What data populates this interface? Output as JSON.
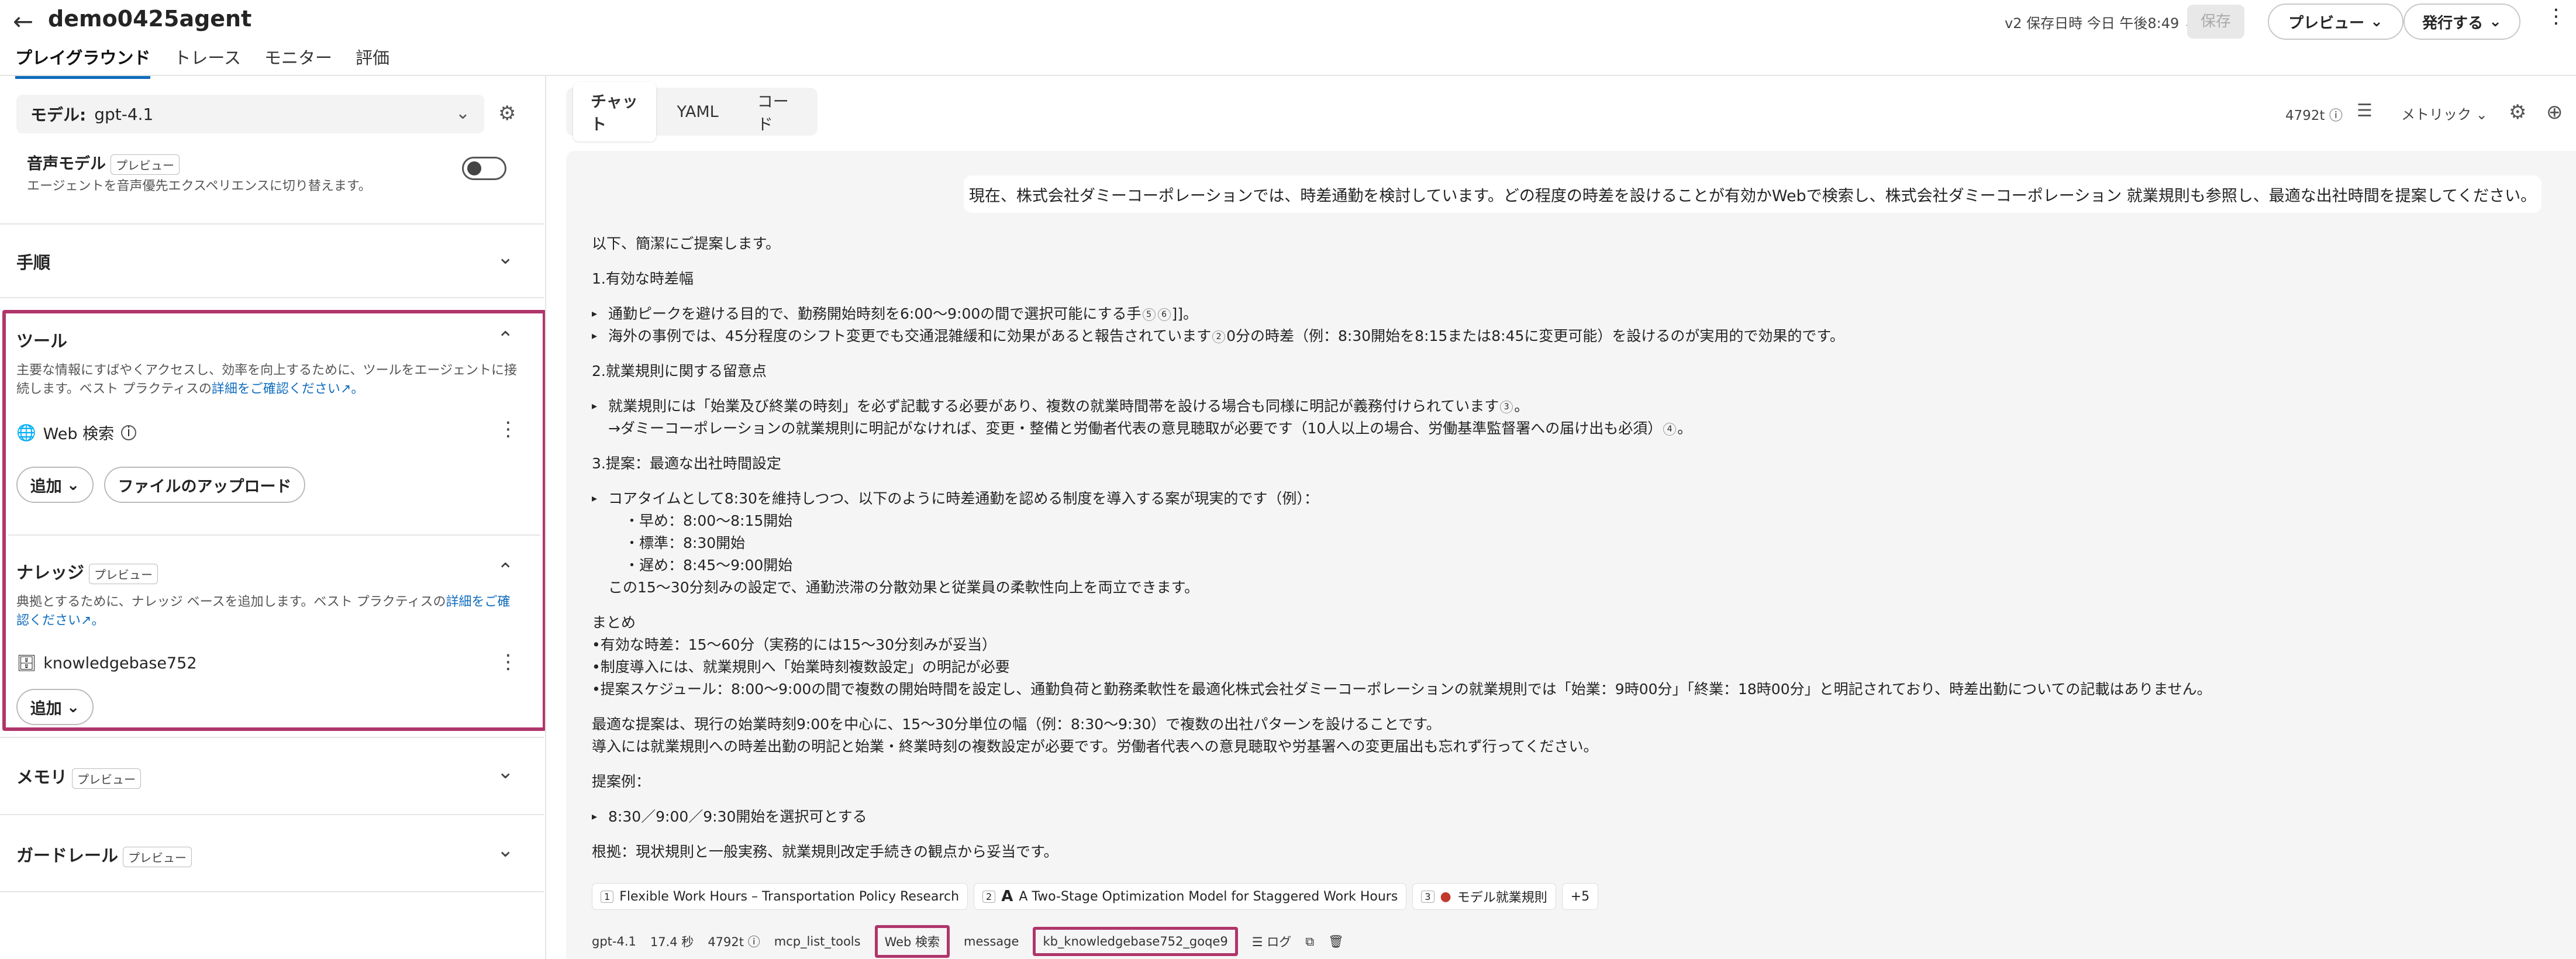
{
  "header": {
    "title": "demo0425agent",
    "tabs": [
      "プレイグラウンド",
      "トレース",
      "モニター",
      "評価"
    ],
    "saved_info": "v2 保存日時 今日 午後8:49",
    "save_label": "保存",
    "preview_label": "プレビュー",
    "publish_label": "発行する"
  },
  "left": {
    "model_prefix": "モデル:",
    "model_value": "gpt-4.1",
    "voice": {
      "label": "音声モデル",
      "badge": "プレビュー",
      "desc": "エージェントを音声優先エクスペリエンスに切り替えます。"
    },
    "instructions_title": "手順",
    "tools": {
      "title": "ツール",
      "desc": "主要な情報にすばやくアクセスし、効率を向上するために、ツールをエージェントに接続します。ベスト プラクティスの",
      "link": "詳細をご確認ください",
      "item": "Web 検索",
      "add_label": "追加",
      "upload_label": "ファイルのアップロード"
    },
    "knowledge": {
      "title": "ナレッジ",
      "badge": "プレビュー",
      "desc": "典拠とするために、ナレッジ ベースを追加します。ベスト プラクティスの",
      "link": "詳細をご確認ください",
      "item": "knowledgebase752",
      "add_label": "追加"
    },
    "memory": {
      "title": "メモリ",
      "badge": "プレビュー"
    },
    "guardrail": {
      "title": "ガードレール",
      "badge": "プレビュー"
    }
  },
  "right": {
    "tabs": [
      "チャット",
      "YAML",
      "コード"
    ],
    "tokens": "4792t",
    "metric_label": "メトリック",
    "user_message": "現在、株式会社ダミーコーポレーションでは、時差通勤を検討しています。どの程度の時差を設けることが有効かWebで検索し、株式会社ダミーコーポレーション 就業規則も参照し、最適な出社時間を提案してください。",
    "answer": {
      "intro": "以下、簡潔にご提案します。",
      "s1": "1.有効な時差幅",
      "s1b1": "通勤ピークを避ける目的で、勤務開始時刻を6:00〜9:00の間で選択可能にする手",
      "s1b1_cites": [
        "5",
        "6"
      ],
      "s1b1_end": "]]。",
      "s1b2": "海外の事例では、45分程度のシフト変更でも交通混雑緩和に効果があると報告されています",
      "s1b2_cite": "2",
      "s1b2_end": "0分の時差（例：8:30開始を8:15または8:45に変更可能）を設けるのが実用的で効果的です。",
      "s2": "2.就業規則に関する留意点",
      "s2b1": "就業規則には「始業及び終業の時刻」を必ず記載する必要があり、複数の就業時間帯を設ける場合も同様に明記が義務付けられています",
      "s2b1_cite": "3",
      "s2b1_end": "。",
      "s2b2": "→ダミーコーポレーションの就業規則に明記がなければ、変更・整備と労働者代表の意見聴取が必要です（10人以上の場合、労働基準監督署への届け出も必須）",
      "s2b2_cite": "4",
      "s2b2_end": "。",
      "s3": "3.提案：最適な出社時間設定",
      "s3b1": "コアタイムとして8:30を維持しつつ、以下のように時差通勤を認める制度を導入する案が現実的です（例）：",
      "s3i1": "・早め：8:00〜8:15開始",
      "s3i2": "・標準：8:30開始",
      "s3i3": "・遅め：8:45〜9:00開始",
      "s3end": "この15〜30分刻みの設定で、通勤渋滞の分散効果と従業員の柔軟性向上を両立できます。",
      "sum_title": "まとめ",
      "sum1": "•有効な時差：15〜60分（実務的には15〜30分刻みが妥当）",
      "sum2": "•制度導入には、就業規則へ「始業時刻複数設定」の明記が必要",
      "sum3": "•提案スケジュール：8:00〜9:00の間で複数の開始時間を設定し、通勤負荷と勤務柔軟性を最適化株式会社ダミーコーポレーションの就業規則では「始業：9時00分」「終業：18時00分」と明記されており、時差出勤についての記載はありません。",
      "final1": "最適な提案は、現行の始業時刻9:00を中心に、15〜30分単位の幅（例：8:30〜9:30）で複数の出社パターンを設けることです。",
      "final2": "導入には就業規則への時差出勤の明記と始業・終業時刻の複数設定が必要です。労働者代表への意見聴取や労基署への変更届出も忘れず行ってください。",
      "ex_title": "提案例：",
      "ex1": "8:30／9:00／9:30開始を選択可とする",
      "basis": "根拠：現状規則と一般実務、就業規則改定手続きの観点から妥当です。"
    },
    "refs": [
      {
        "num": "1",
        "title": "Flexible Work Hours – Transportation Policy Research"
      },
      {
        "num": "2",
        "title": "A Two-Stage Optimization Model for Staggered Work Hours"
      },
      {
        "num": "3",
        "title": "モデル就業規則"
      }
    ],
    "refs_more": "+5",
    "meta": {
      "model": "gpt-4.1",
      "duration": "17.4 秒",
      "tokens": "4792t",
      "step1": "mcp_list_tools",
      "step2": "Web 検索",
      "step3": "message",
      "step4": "kb_knowledgebase752_goqe9",
      "log": "ログ"
    }
  }
}
